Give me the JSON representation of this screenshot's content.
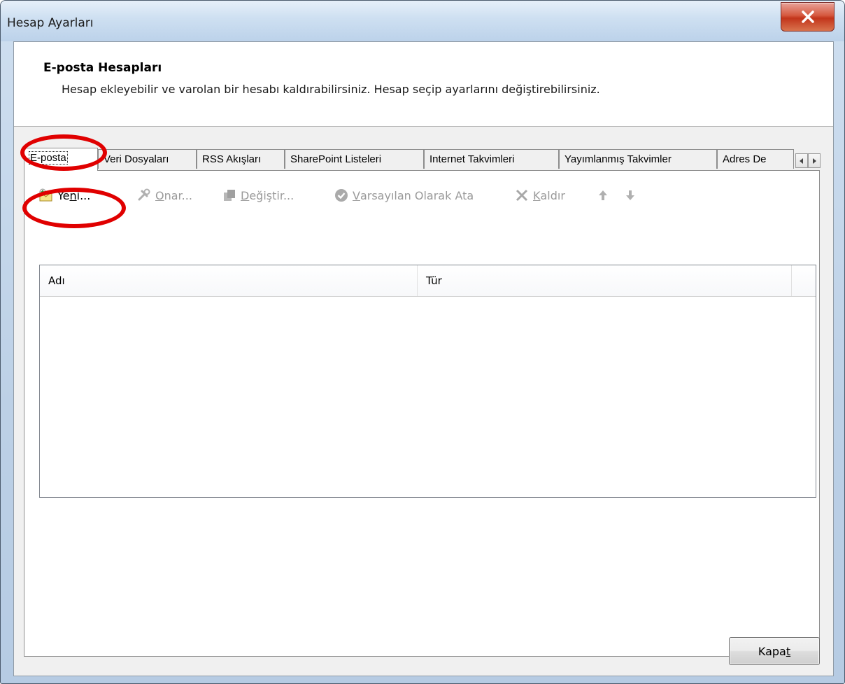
{
  "window": {
    "title": "Hesap Ayarları",
    "close_glyph": "close-x-icon"
  },
  "header": {
    "title": "E-posta Hesapları",
    "subtitle": "Hesap ekleyebilir ve varolan bir hesabı kaldırabilirsiniz. Hesap seçip ayarlarını değiştirebilirsiniz."
  },
  "tabs": [
    {
      "label": "E-posta",
      "active": true
    },
    {
      "label": "Veri Dosyaları",
      "active": false
    },
    {
      "label": "RSS Akışları",
      "active": false
    },
    {
      "label": "SharePoint Listeleri",
      "active": false
    },
    {
      "label": "Internet Takvimleri",
      "active": false
    },
    {
      "label": "Yayımlanmış Takvimler",
      "active": false
    },
    {
      "label": "Adres De",
      "active": false
    }
  ],
  "toolbar": {
    "new": {
      "pre": "Ye",
      "key": "n",
      "post": "i...",
      "enabled": true
    },
    "repair": {
      "pre": "",
      "key": "O",
      "post": "nar...",
      "enabled": false
    },
    "change": {
      "pre": "",
      "key": "D",
      "post": "eğiştir...",
      "enabled": false
    },
    "set_default": {
      "pre": "",
      "key": "V",
      "post": "arsayılan Olarak Ata",
      "enabled": false
    },
    "remove": {
      "pre": "",
      "key": "K",
      "post": "aldır",
      "enabled": false
    }
  },
  "list": {
    "columns": [
      "Adı",
      "Tür"
    ],
    "rows": []
  },
  "footer": {
    "close": {
      "pre": "Kapa",
      "key": "t",
      "post": ""
    }
  },
  "colors": {
    "highlight": "#e00000",
    "title_bar": "#cddff1",
    "dialog_bg": "#f0f0f0"
  }
}
